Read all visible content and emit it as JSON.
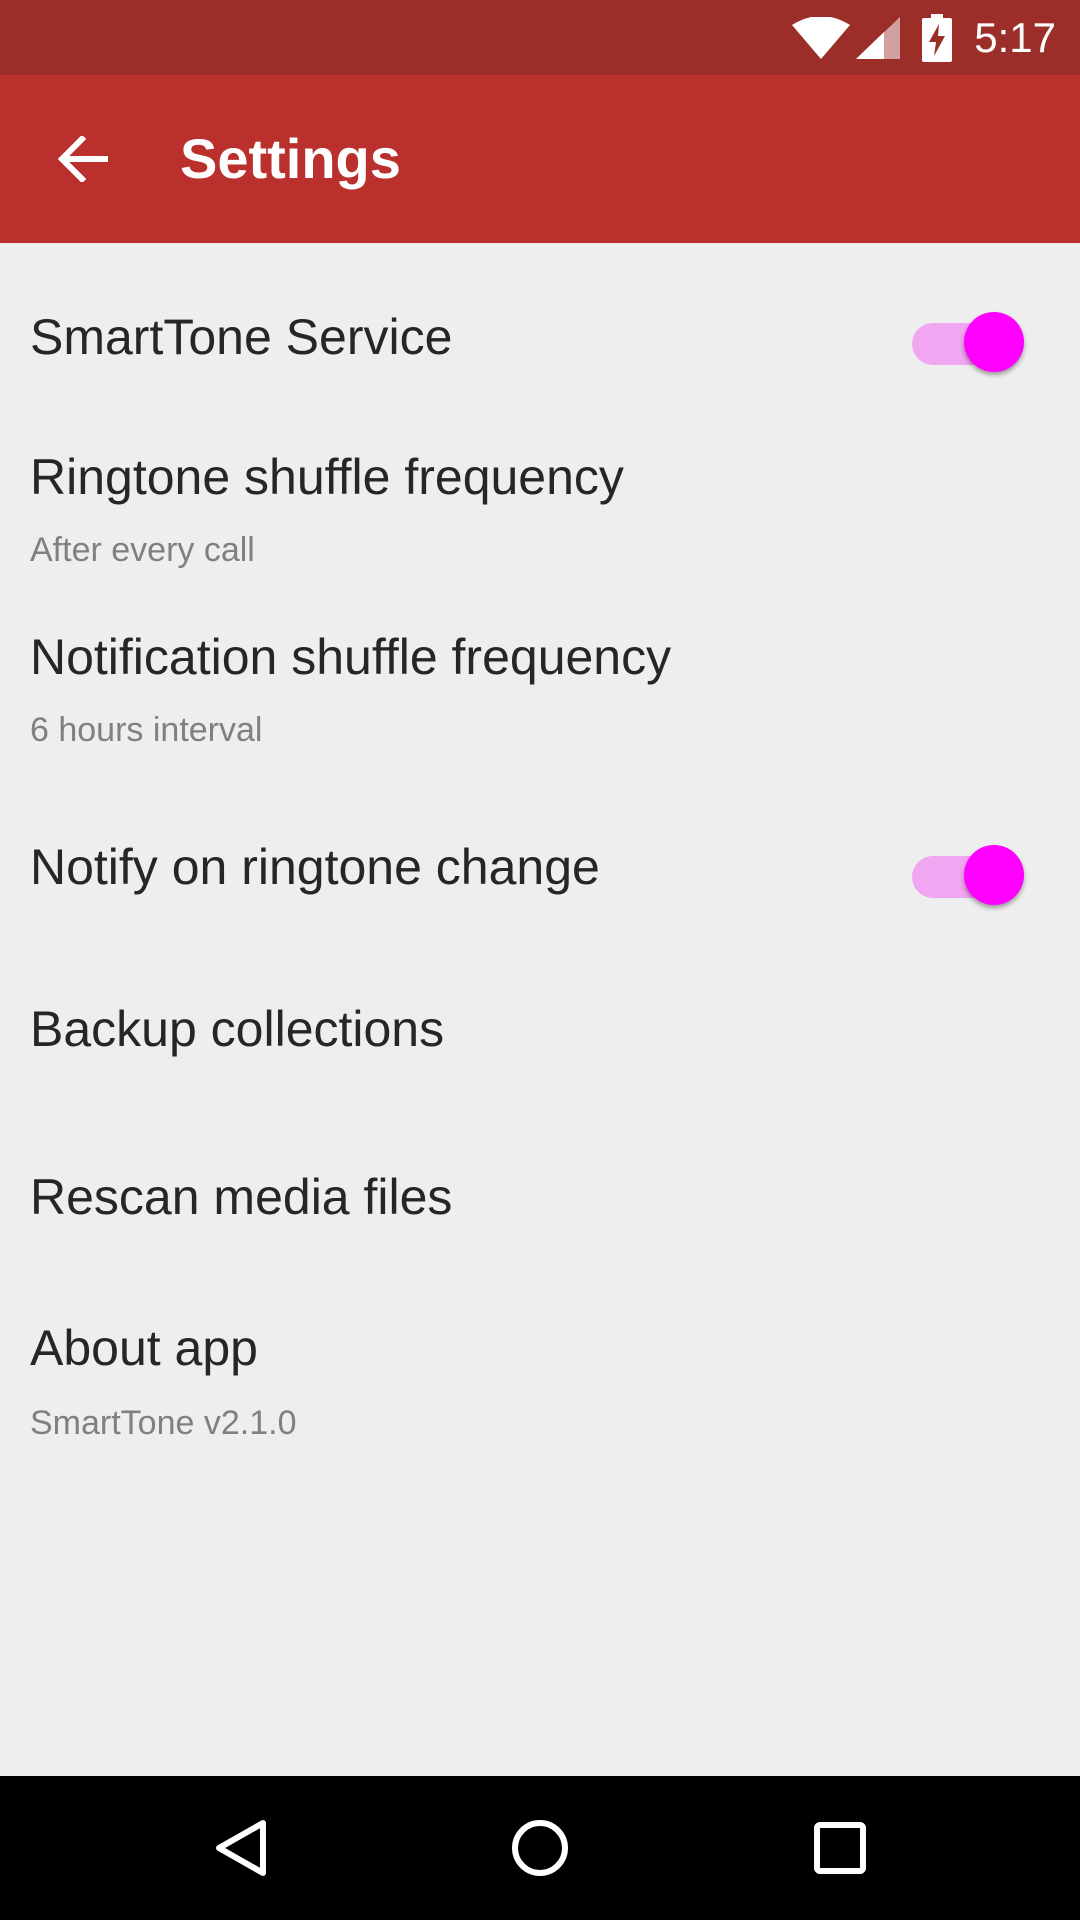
{
  "status_bar": {
    "time": "5:17",
    "icons": [
      "wifi-icon",
      "cell-signal-icon",
      "battery-charging-icon"
    ]
  },
  "app_bar": {
    "title": "Settings",
    "back_icon": "arrow-back-icon"
  },
  "settings": {
    "smarttone_service": {
      "title": "SmartTone Service",
      "enabled": true
    },
    "ringtone_shuffle": {
      "title": "Ringtone shuffle frequency",
      "summary": "After every call"
    },
    "notification_shuffle": {
      "title": "Notification shuffle frequency",
      "summary": "6 hours interval"
    },
    "notify_change": {
      "title": "Notify on ringtone change",
      "enabled": true
    },
    "backup": {
      "title": "Backup collections"
    },
    "rescan": {
      "title": "Rescan media files"
    },
    "about": {
      "title": "About app",
      "summary": "SmartTone v2.1.0"
    }
  },
  "nav_bar": {
    "icons": [
      "back-triangle-icon",
      "home-circle-icon",
      "recents-square-icon"
    ]
  },
  "colors": {
    "status_bar": "#9b2e28",
    "app_bar": "#b9302c",
    "background": "#eeeeee",
    "switch_thumb": "#ff00ff",
    "switch_track": "#f0a6f0",
    "title_text": "#262626",
    "summary_text": "#808080"
  }
}
